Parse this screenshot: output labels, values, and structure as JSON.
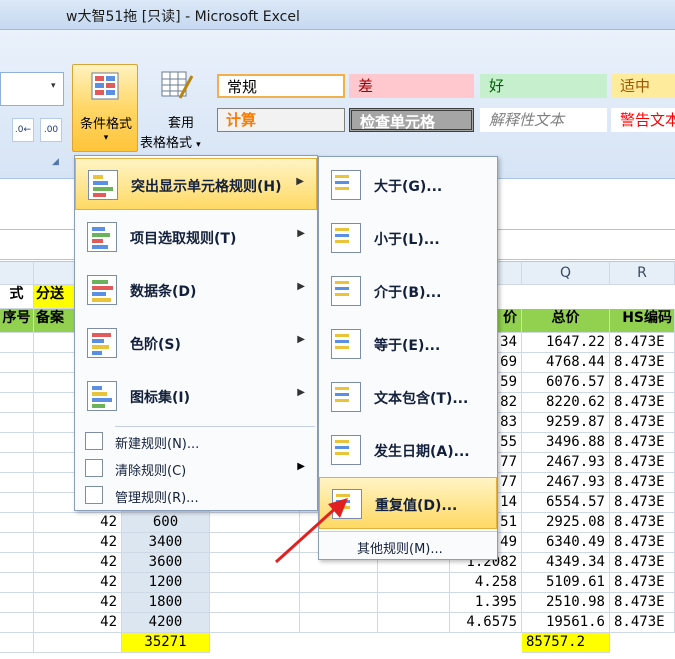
{
  "window": {
    "title": "w大智51拖  [只读] - Microsoft Excel"
  },
  "ribbon": {
    "left_buttons": [
      ".0 .00",
      ".00 →.0"
    ],
    "conditional_format": {
      "label": "条件格式",
      "arrow": "▾"
    },
    "apply_format": {
      "label_line1": "套用",
      "label_line2": "表格格式",
      "arrow": "▾"
    },
    "styles": [
      {
        "text": "常规",
        "bg": "#ffffff",
        "color": "#000000"
      },
      {
        "text": "差",
        "bg": "#ffc7ce",
        "color": "#9c0006"
      },
      {
        "text": "好",
        "bg": "#c6efce",
        "color": "#006100"
      },
      {
        "text": "适中",
        "bg": "#ffeb9c",
        "color": "#9c5700"
      },
      {
        "text": "计算",
        "bg": "#f2f2f2",
        "color": "#fa7d00"
      },
      {
        "text": "检查单元格",
        "bg": "#a5a5a5",
        "color": "#ffffff"
      },
      {
        "text": "解释性文本",
        "bg": "#ffffff",
        "color": "#7f7f7f"
      },
      {
        "text": "警告文本",
        "bg": "#ffffff",
        "color": "#ff0000"
      }
    ]
  },
  "main_menu": {
    "items": [
      {
        "label": "突出显示单元格规则(H)",
        "has_sub": true,
        "icon": "highlight-cells-icon",
        "highlighted": true
      },
      {
        "label": "项目选取规则(T)",
        "has_sub": true,
        "icon": "top-bottom-icon"
      },
      {
        "label": "数据条(D)",
        "has_sub": true,
        "icon": "data-bars-icon"
      },
      {
        "label": "色阶(S)",
        "has_sub": true,
        "icon": "color-scale-icon"
      },
      {
        "label": "图标集(I)",
        "has_sub": true,
        "icon": "icon-sets-icon"
      }
    ],
    "small_items": [
      {
        "label": "新建规则(N)...",
        "icon": "new-rule-icon"
      },
      {
        "label": "清除规则(C)",
        "has_sub": true,
        "icon": "clear-rules-icon"
      },
      {
        "label": "管理规则(R)...",
        "icon": "manage-rules-icon"
      }
    ]
  },
  "sub_menu": {
    "items": [
      {
        "label": "大于(G)...",
        "icon": "greater-than-icon"
      },
      {
        "label": "小于(L)...",
        "icon": "less-than-icon"
      },
      {
        "label": "介于(B)...",
        "icon": "between-icon"
      },
      {
        "label": "等于(E)...",
        "icon": "equal-to-icon"
      },
      {
        "label": "文本包含(T)...",
        "icon": "text-contains-icon"
      },
      {
        "label": "发生日期(A)...",
        "icon": "date-occurring-icon"
      },
      {
        "label": "重复值(D)...",
        "icon": "duplicate-values-icon",
        "highlighted": true
      }
    ],
    "more": "其他规则(M)..."
  },
  "sheet": {
    "col_headers": [
      "Q",
      "R"
    ],
    "header_row1": {
      "a": "式",
      "b": "分送"
    },
    "header_row2": {
      "a": "序号",
      "b": "备案",
      "p": "价",
      "q": "总价",
      "r": "HS编码"
    },
    "rows": [
      {
        "b": "4",
        "d": "",
        "p": "34",
        "q": "1647.22",
        "r": "8.473E"
      },
      {
        "b": "4",
        "d": "",
        "p": "69",
        "q": "4768.44",
        "r": "8.473E"
      },
      {
        "b": "4",
        "d": "",
        "p": "59",
        "q": "6076.57",
        "r": "8.473E"
      },
      {
        "b": "4",
        "d": "",
        "p": "82",
        "q": "8220.62",
        "r": "8.473E"
      },
      {
        "b": "4",
        "d": "",
        "p": "83",
        "q": "9259.87",
        "r": "8.473E"
      },
      {
        "b": "4",
        "d": "",
        "p": "55",
        "q": "3496.88",
        "r": "8.473E"
      },
      {
        "b": "4",
        "d": "",
        "p": "77",
        "q": "2467.93",
        "r": "8.473E"
      },
      {
        "b": "4",
        "d": "",
        "p": "77",
        "q": "2467.93",
        "r": "8.473E"
      },
      {
        "b": "4",
        "d": "",
        "p": "14",
        "q": "6554.57",
        "r": "8.473E"
      },
      {
        "b": "42",
        "d": "600",
        "p": "51",
        "q": "2925.08",
        "r": "8.473E"
      },
      {
        "b": "42",
        "d": "3400",
        "p": "49",
        "q": "6340.49",
        "r": "8.473E"
      },
      {
        "b": "42",
        "d": "3600",
        "p": "1.2082",
        "q": "4349.34",
        "r": "8.473E"
      },
      {
        "b": "42",
        "d": "1200",
        "p": "4.258",
        "q": "5109.61",
        "r": "8.473E"
      },
      {
        "b": "42",
        "d": "1800",
        "p": "1.395",
        "q": "2510.98",
        "r": "8.473E"
      },
      {
        "b": "42",
        "d": "4200",
        "p": "4.6575",
        "q": "19561.6",
        "r": "8.473E"
      }
    ],
    "total_d": "35271",
    "total_q": "85757.2"
  }
}
